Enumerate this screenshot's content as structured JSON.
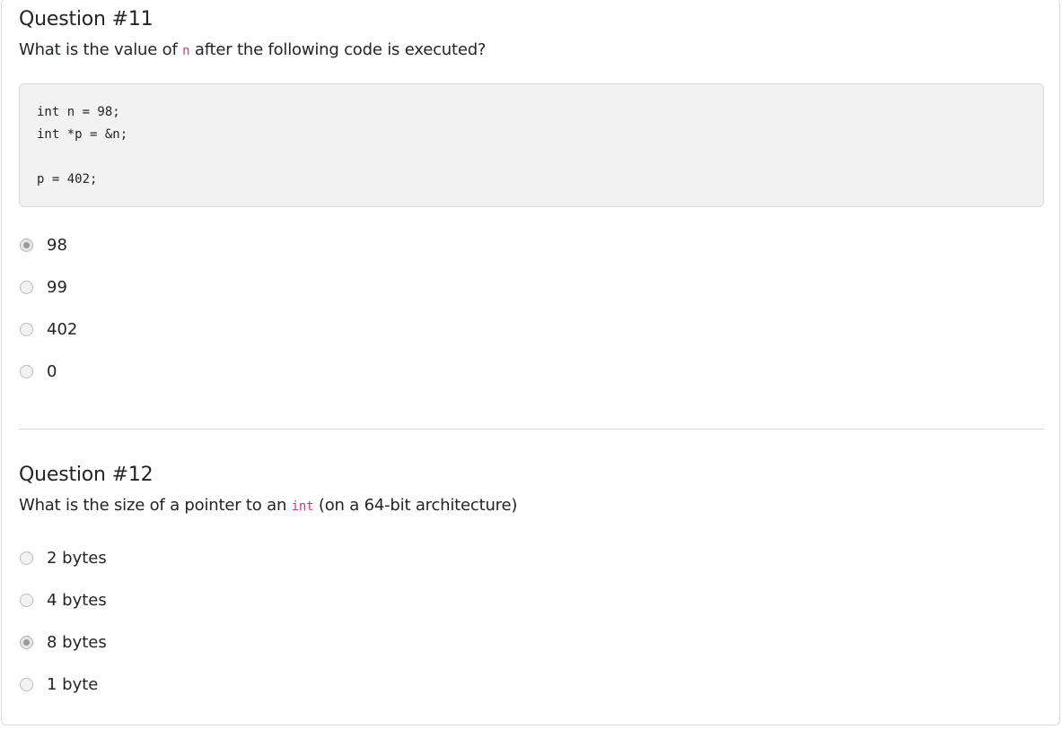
{
  "q11": {
    "title": "Question #11",
    "prompt_before": "What is the value of ",
    "prompt_code": "n",
    "prompt_after": " after the following code is executed?",
    "code_lines": [
      "int n = 98;",
      "int *p = &n;",
      "",
      "p = 402;"
    ],
    "options": [
      {
        "label": "98",
        "checked": true
      },
      {
        "label": "99",
        "checked": false
      },
      {
        "label": "402",
        "checked": false
      },
      {
        "label": "0",
        "checked": false
      }
    ]
  },
  "q12": {
    "title": "Question #12",
    "prompt_before": "What is the size of a pointer to an ",
    "prompt_code": "int",
    "prompt_after": " (on a 64-bit architecture)",
    "options": [
      {
        "label": "2 bytes",
        "checked": false
      },
      {
        "label": "4 bytes",
        "checked": false
      },
      {
        "label": "8 bytes",
        "checked": true
      },
      {
        "label": "1 byte",
        "checked": false
      }
    ]
  }
}
